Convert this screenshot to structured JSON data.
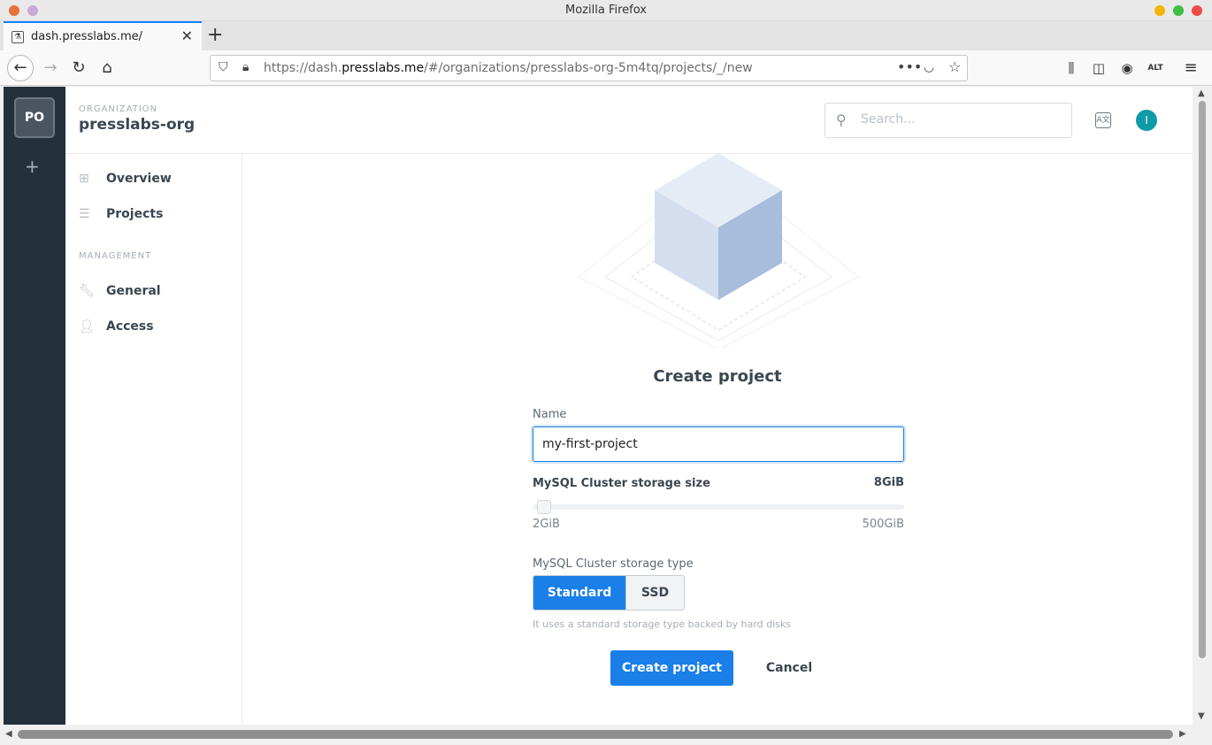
{
  "window": {
    "title": "Mozilla Firefox"
  },
  "tab": {
    "title": "dash.presslabs.me/"
  },
  "url": {
    "scheme": "https://dash.",
    "domain": "presslabs.me",
    "path": "/#/organizations/presslabs-org-5m4tq/projects/_/new"
  },
  "org_switcher": {
    "initials": "PO",
    "add_label": "+"
  },
  "header": {
    "org_label": "ORGANIZATION",
    "org_name": "presslabs-org",
    "search_placeholder": "Search...",
    "user_initial": "I"
  },
  "sidebar": {
    "items": [
      {
        "label": "Overview",
        "icon": "grid-icon"
      },
      {
        "label": "Projects",
        "icon": "list-icon"
      }
    ],
    "management_label": "MANAGEMENT",
    "management_items": [
      {
        "label": "General",
        "icon": "wrench-icon"
      },
      {
        "label": "Access",
        "icon": "user-lock-icon"
      }
    ]
  },
  "form": {
    "title": "Create project",
    "name_label": "Name",
    "name_value": "my-first-project",
    "storage_size_label": "MySQL Cluster storage size",
    "storage_size_value": "8GiB",
    "storage_size_fraction": 0.012,
    "storage_min": "2GiB",
    "storage_max": "500GiB",
    "storage_type_label": "MySQL Cluster storage type",
    "storage_types": [
      "Standard",
      "SSD"
    ],
    "storage_type_selected": "Standard",
    "storage_type_hint": "It uses a standard storage type backed by hard disks",
    "submit_label": "Create project",
    "cancel_label": "Cancel"
  },
  "colors": {
    "accent": "#1a7fe8",
    "sidebar_dark": "#24303b",
    "avatar": "#0e9aa7"
  }
}
